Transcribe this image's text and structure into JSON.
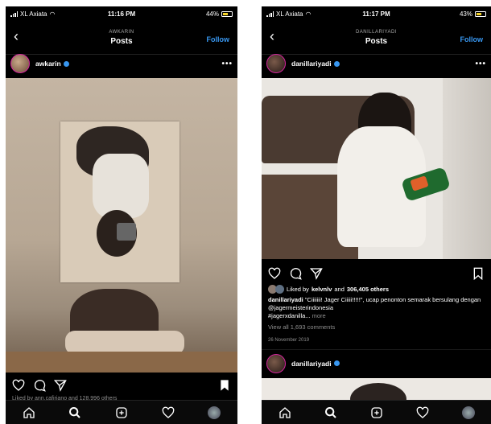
{
  "left": {
    "status": {
      "carrier": "XL Axiata",
      "time": "11:16 PM",
      "battery": "44%"
    },
    "nav": {
      "subtitle": "AWKARIN",
      "title": "Posts",
      "follow": "Follow"
    },
    "post": {
      "username": "awkarin"
    },
    "liked_by_partial": "Liked by ann.cafiriano and 128,996 others"
  },
  "right": {
    "status": {
      "carrier": "XL Axiata",
      "time": "11:17 PM",
      "battery": "43%"
    },
    "nav": {
      "subtitle": "DANILLARIYADI",
      "title": "Posts",
      "follow": "Follow"
    },
    "post": {
      "username": "danillariyadi",
      "liked_prefix": "Liked by",
      "liked_user": "kelvnlv",
      "liked_and": "and",
      "liked_count": "306,405 others",
      "caption_user": "danillariyadi",
      "caption_text": "\"Ciiiiiii! Jager Ciiiii!!!!!\", ucap penonton semarak bersulang dengan",
      "caption_mention": "@jagermeisterindonesia",
      "caption_tags": "#jagerxdanilla...",
      "caption_more": "more",
      "view_comments": "View all 1,693 comments",
      "date": "26 November 2019"
    },
    "next_post": {
      "username": "danillariyadi"
    }
  },
  "icons": [
    "heart-icon",
    "comment-icon",
    "share-icon",
    "bookmark-icon",
    "home-icon",
    "search-icon",
    "add-icon",
    "activity-icon",
    "profile-icon"
  ],
  "colors": {
    "accent": "#3897f0",
    "background": "#000000",
    "text": "#ffffff",
    "muted": "#8e8e8e"
  }
}
